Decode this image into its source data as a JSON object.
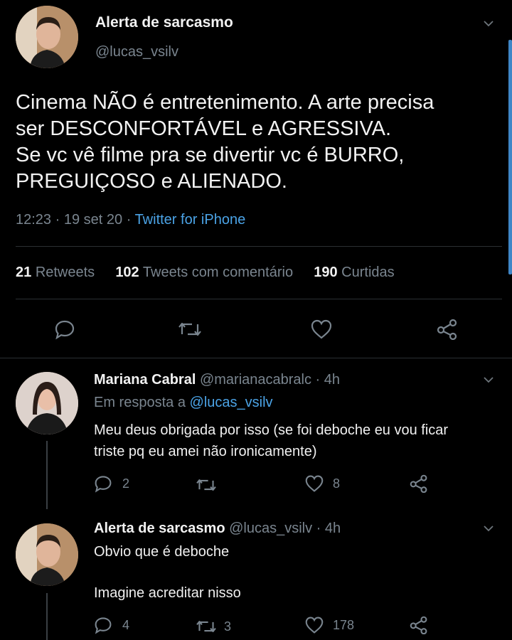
{
  "main_tweet": {
    "display_name": "Alerta de sarcasmo",
    "handle": "@lucas_vsilv",
    "text_lines": [
      "Cinema NÃO é entretenimento. A arte precisa",
      "ser DESCONFORTÁVEL e AGRESSIVA.",
      "Se vc vê filme pra se divertir vc é BURRO,",
      "PREGUIÇOSO e ALIENADO."
    ],
    "time": "12:23",
    "date": "19 set 20",
    "source": "Twitter for iPhone",
    "stats": {
      "retweets_count": "21",
      "retweets_label": "Retweets",
      "quotes_count": "102",
      "quotes_label": "Tweets com comentário",
      "likes_count": "190",
      "likes_label": "Curtidas"
    }
  },
  "replies": [
    {
      "display_name": "Mariana Cabral",
      "handle": "@marianacabralc",
      "age": "4h",
      "reply_prefix": "Em resposta a",
      "reply_to": "@lucas_vsilv",
      "text_lines": [
        "Meu deus obrigada por isso (se foi deboche eu vou ficar",
        "triste pq eu amei não ironicamente)"
      ],
      "reply_count": "2",
      "retweet_count": "",
      "like_count": "8"
    },
    {
      "display_name": "Alerta de sarcasmo",
      "handle": "@lucas_vsilv",
      "age": "4h",
      "text_lines": [
        "Obvio que é deboche",
        "",
        "Imagine acreditar nisso"
      ],
      "reply_count": "4",
      "retweet_count": "3",
      "like_count": "178"
    }
  ],
  "colors": {
    "background": "#000000",
    "link": "#4ba3e6",
    "muted": "#7a858f",
    "divider": "#2b2f33"
  },
  "icons": [
    "reply-icon",
    "retweet-icon",
    "like-icon",
    "share-icon",
    "chevron-down-icon"
  ]
}
